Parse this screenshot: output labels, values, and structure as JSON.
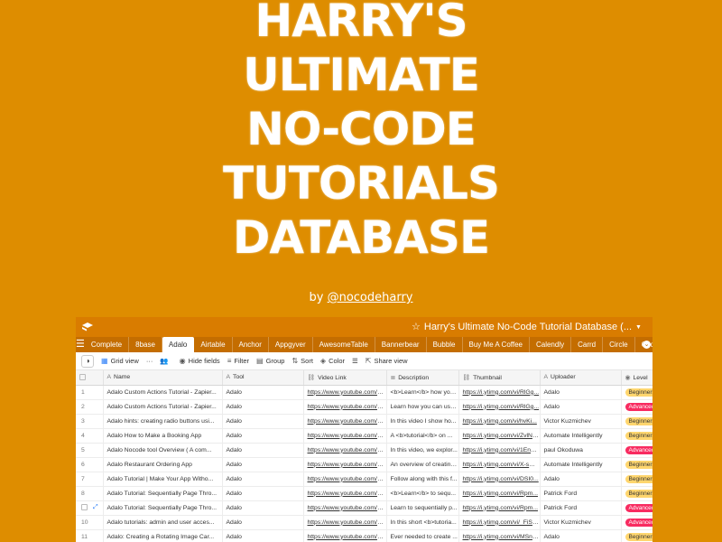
{
  "hero": {
    "lines": [
      "HARRY'S",
      "ULTIMATE",
      "NO-CODE",
      "TUTORIALS",
      "DATABASE"
    ],
    "by": "by",
    "handle": "@nocodeharry"
  },
  "app": {
    "base_title": "Harry's Ultimate No-Code Tutorial Database (...",
    "tabs": [
      "Complete",
      "8base",
      "Adalo",
      "Airtable",
      "Anchor",
      "Appgyver",
      "AwesomeTable",
      "Bannerbear",
      "Bubble",
      "Buy Me A Coffee",
      "Calendly",
      "Carrd",
      "Circle",
      "Cod"
    ],
    "active_tab": "Adalo",
    "toolbar": {
      "view": "Grid view",
      "hide_fields": "Hide fields",
      "filter": "Filter",
      "group": "Group",
      "sort": "Sort",
      "color": "Color",
      "share_view": "Share view"
    },
    "columns": [
      "Name",
      "Tool",
      "Video Link",
      "Description",
      "Thumbnail",
      "Uploader",
      "Level"
    ],
    "rows": [
      {
        "n": "1",
        "name": "Adalo Custom Actions Tutorial - Zapier...",
        "tool": "Adalo",
        "video": "https://www.youtube.com/w...",
        "desc": "<b>Learn</b> how you...",
        "thumb": "https://i.ytimg.com/vi/RlGg...",
        "uploader": "Adalo",
        "level": "Beginners"
      },
      {
        "n": "2",
        "name": "Adalo Custom Actions Tutorial - Zapier...",
        "tool": "Adalo",
        "video": "https://www.youtube.com/w...",
        "desc": "Learn how you can use ...",
        "thumb": "https://i.ytimg.com/vi/RlGg...",
        "uploader": "Adalo",
        "level": "Advanced"
      },
      {
        "n": "3",
        "name": "Adalo hints: creating radio buttons usi...",
        "tool": "Adalo",
        "video": "https://www.youtube.com/w...",
        "desc": "In this video I show ho...",
        "thumb": "https://i.ytimg.com/vi/hvKi...",
        "uploader": "Victor Kuzmichev",
        "level": "Beginners"
      },
      {
        "n": "4",
        "name": "Adalo How to Make a Booking App",
        "tool": "Adalo",
        "video": "https://www.youtube.com/w...",
        "desc": "A <b>tutorial</b> on ...",
        "thumb": "https://i.ytimg.com/vi/ZvlN-...",
        "uploader": "Automate Intelligently",
        "level": "Beginners"
      },
      {
        "n": "5",
        "name": "Adalo Nocode tool Overview ( A com...",
        "tool": "Adalo",
        "video": "https://www.youtube.com/w...",
        "desc": "In this video, we explor...",
        "thumb": "https://i.ytimg.com/vi/1EnD...",
        "uploader": "paul Okoduwa",
        "level": "Advanced"
      },
      {
        "n": "6",
        "name": "Adalo Restaurant Ordering App",
        "tool": "Adalo",
        "video": "https://www.youtube.com/w...",
        "desc": "An overview of creating...",
        "thumb": "https://i.ytimg.com/vi/X-swj...",
        "uploader": "Automate Intelligently",
        "level": "Beginners"
      },
      {
        "n": "7",
        "name": "Adalo Tutorial | Make Your App Witho...",
        "tool": "Adalo",
        "video": "https://www.youtube.com/w...",
        "desc": "Follow along with this f...",
        "thumb": "https://i.ytimg.com/vi/DSI0...",
        "uploader": "Adalo",
        "level": "Beginners"
      },
      {
        "n": "8",
        "name": "Adalo Tutorial: Sequentially Page Thro...",
        "tool": "Adalo",
        "video": "https://www.youtube.com/w...",
        "desc": "<b>Learn</b> to sequ...",
        "thumb": "https://i.ytimg.com/vi/Rpm...",
        "uploader": "Patrick Ford",
        "level": "Beginners"
      },
      {
        "n": "9",
        "name": "Adalo Tutorial: Sequentially Page Thro...",
        "tool": "Adalo",
        "video": "https://www.youtube.com/w...",
        "desc": "Learn to sequentially p...",
        "thumb": "https://i.ytimg.com/vi/Rpm...",
        "uploader": "Patrick Ford",
        "level": "Advanced"
      },
      {
        "n": "10",
        "name": "Adalo tutorials: admin and user acces...",
        "tool": "Adalo",
        "video": "https://www.youtube.com/w...",
        "desc": "In this short <b>tutoria...",
        "thumb": "https://i.ytimg.com/vi/_FiSo...",
        "uploader": "Victor Kuzmichev",
        "level": "Advanced"
      },
      {
        "n": "11",
        "name": "Adalo: Creating a Rotating Image Car...",
        "tool": "Adalo",
        "video": "https://www.youtube.com/w...",
        "desc": "Ever needed to create ...",
        "thumb": "https://i.ytimg.com/vi/MSn-...",
        "uploader": "Adalo",
        "level": "Beginners"
      }
    ]
  },
  "colors": {
    "background": "#de8d00",
    "topbar": "#d97c00",
    "tabbar": "#c46d00",
    "beginners": "#ffd66e",
    "advanced": "#f82b60"
  },
  "icons": {
    "logo": "airtable-logo-icon",
    "star": "star-icon",
    "menu": "hamburger-icon",
    "grid": "grid-view-icon",
    "more": "more-dots-icon",
    "people": "people-icon",
    "hide": "eye-icon",
    "filter": "filter-icon",
    "group": "group-icon",
    "sort": "sort-icon",
    "color": "paint-bucket-icon",
    "rowheight": "row-height-icon",
    "share": "share-icon",
    "expand": "expand-record-icon"
  }
}
